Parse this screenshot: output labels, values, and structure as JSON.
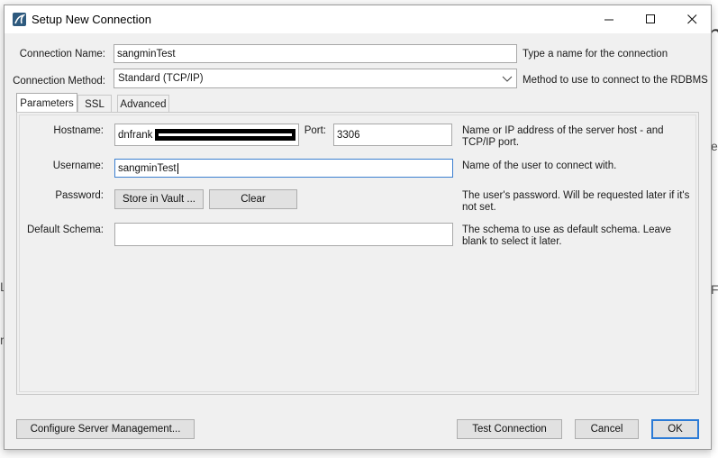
{
  "window": {
    "title": "Setup New Connection",
    "minimize_glyph": "—",
    "maximize_glyph": "☐",
    "close_glyph": "✕"
  },
  "connection": {
    "name_label": "Connection Name:",
    "name_value": "sangminTest",
    "name_help": "Type a name for the connection",
    "method_label": "Connection Method:",
    "method_value": "Standard (TCP/IP)",
    "method_help": "Method to use to connect to the RDBMS"
  },
  "tabs": [
    {
      "label": "Parameters",
      "active": true
    },
    {
      "label": "SSL",
      "active": false
    },
    {
      "label": "Advanced",
      "active": false
    }
  ],
  "parameters": {
    "hostname_label": "Hostname:",
    "hostname_value": "dnfrank",
    "port_label": "Port:",
    "port_value": "3306",
    "hostname_help_1": "Name or IP address of the server host - and",
    "hostname_help_2": "TCP/IP port.",
    "username_label": "Username:",
    "username_value": "sangminTest",
    "username_help": "Name of the user to connect with.",
    "password_label": "Password:",
    "store_vault_label": "Store in Vault ...",
    "clear_label": "Clear",
    "password_help_1": "The user's password. Will be requested later if it's",
    "password_help_2": "not set.",
    "schema_label": "Default Schema:",
    "schema_value": "",
    "schema_help_1": "The schema to use as default schema. Leave",
    "schema_help_2": "blank to select it later."
  },
  "footer": {
    "configure_label": "Configure Server Management...",
    "test_label": "Test Connection",
    "cancel_label": "Cancel",
    "ok_label": "OK"
  },
  "background": {
    "glyph_1": "n",
    "glyph_2": "e",
    "glyph_3": "L",
    "glyph_4": "F",
    "glyph_5": "r"
  },
  "colors": {
    "accent": "#2a7ad6",
    "focus_border": "#3c7fd0",
    "redaction": "#000000"
  }
}
